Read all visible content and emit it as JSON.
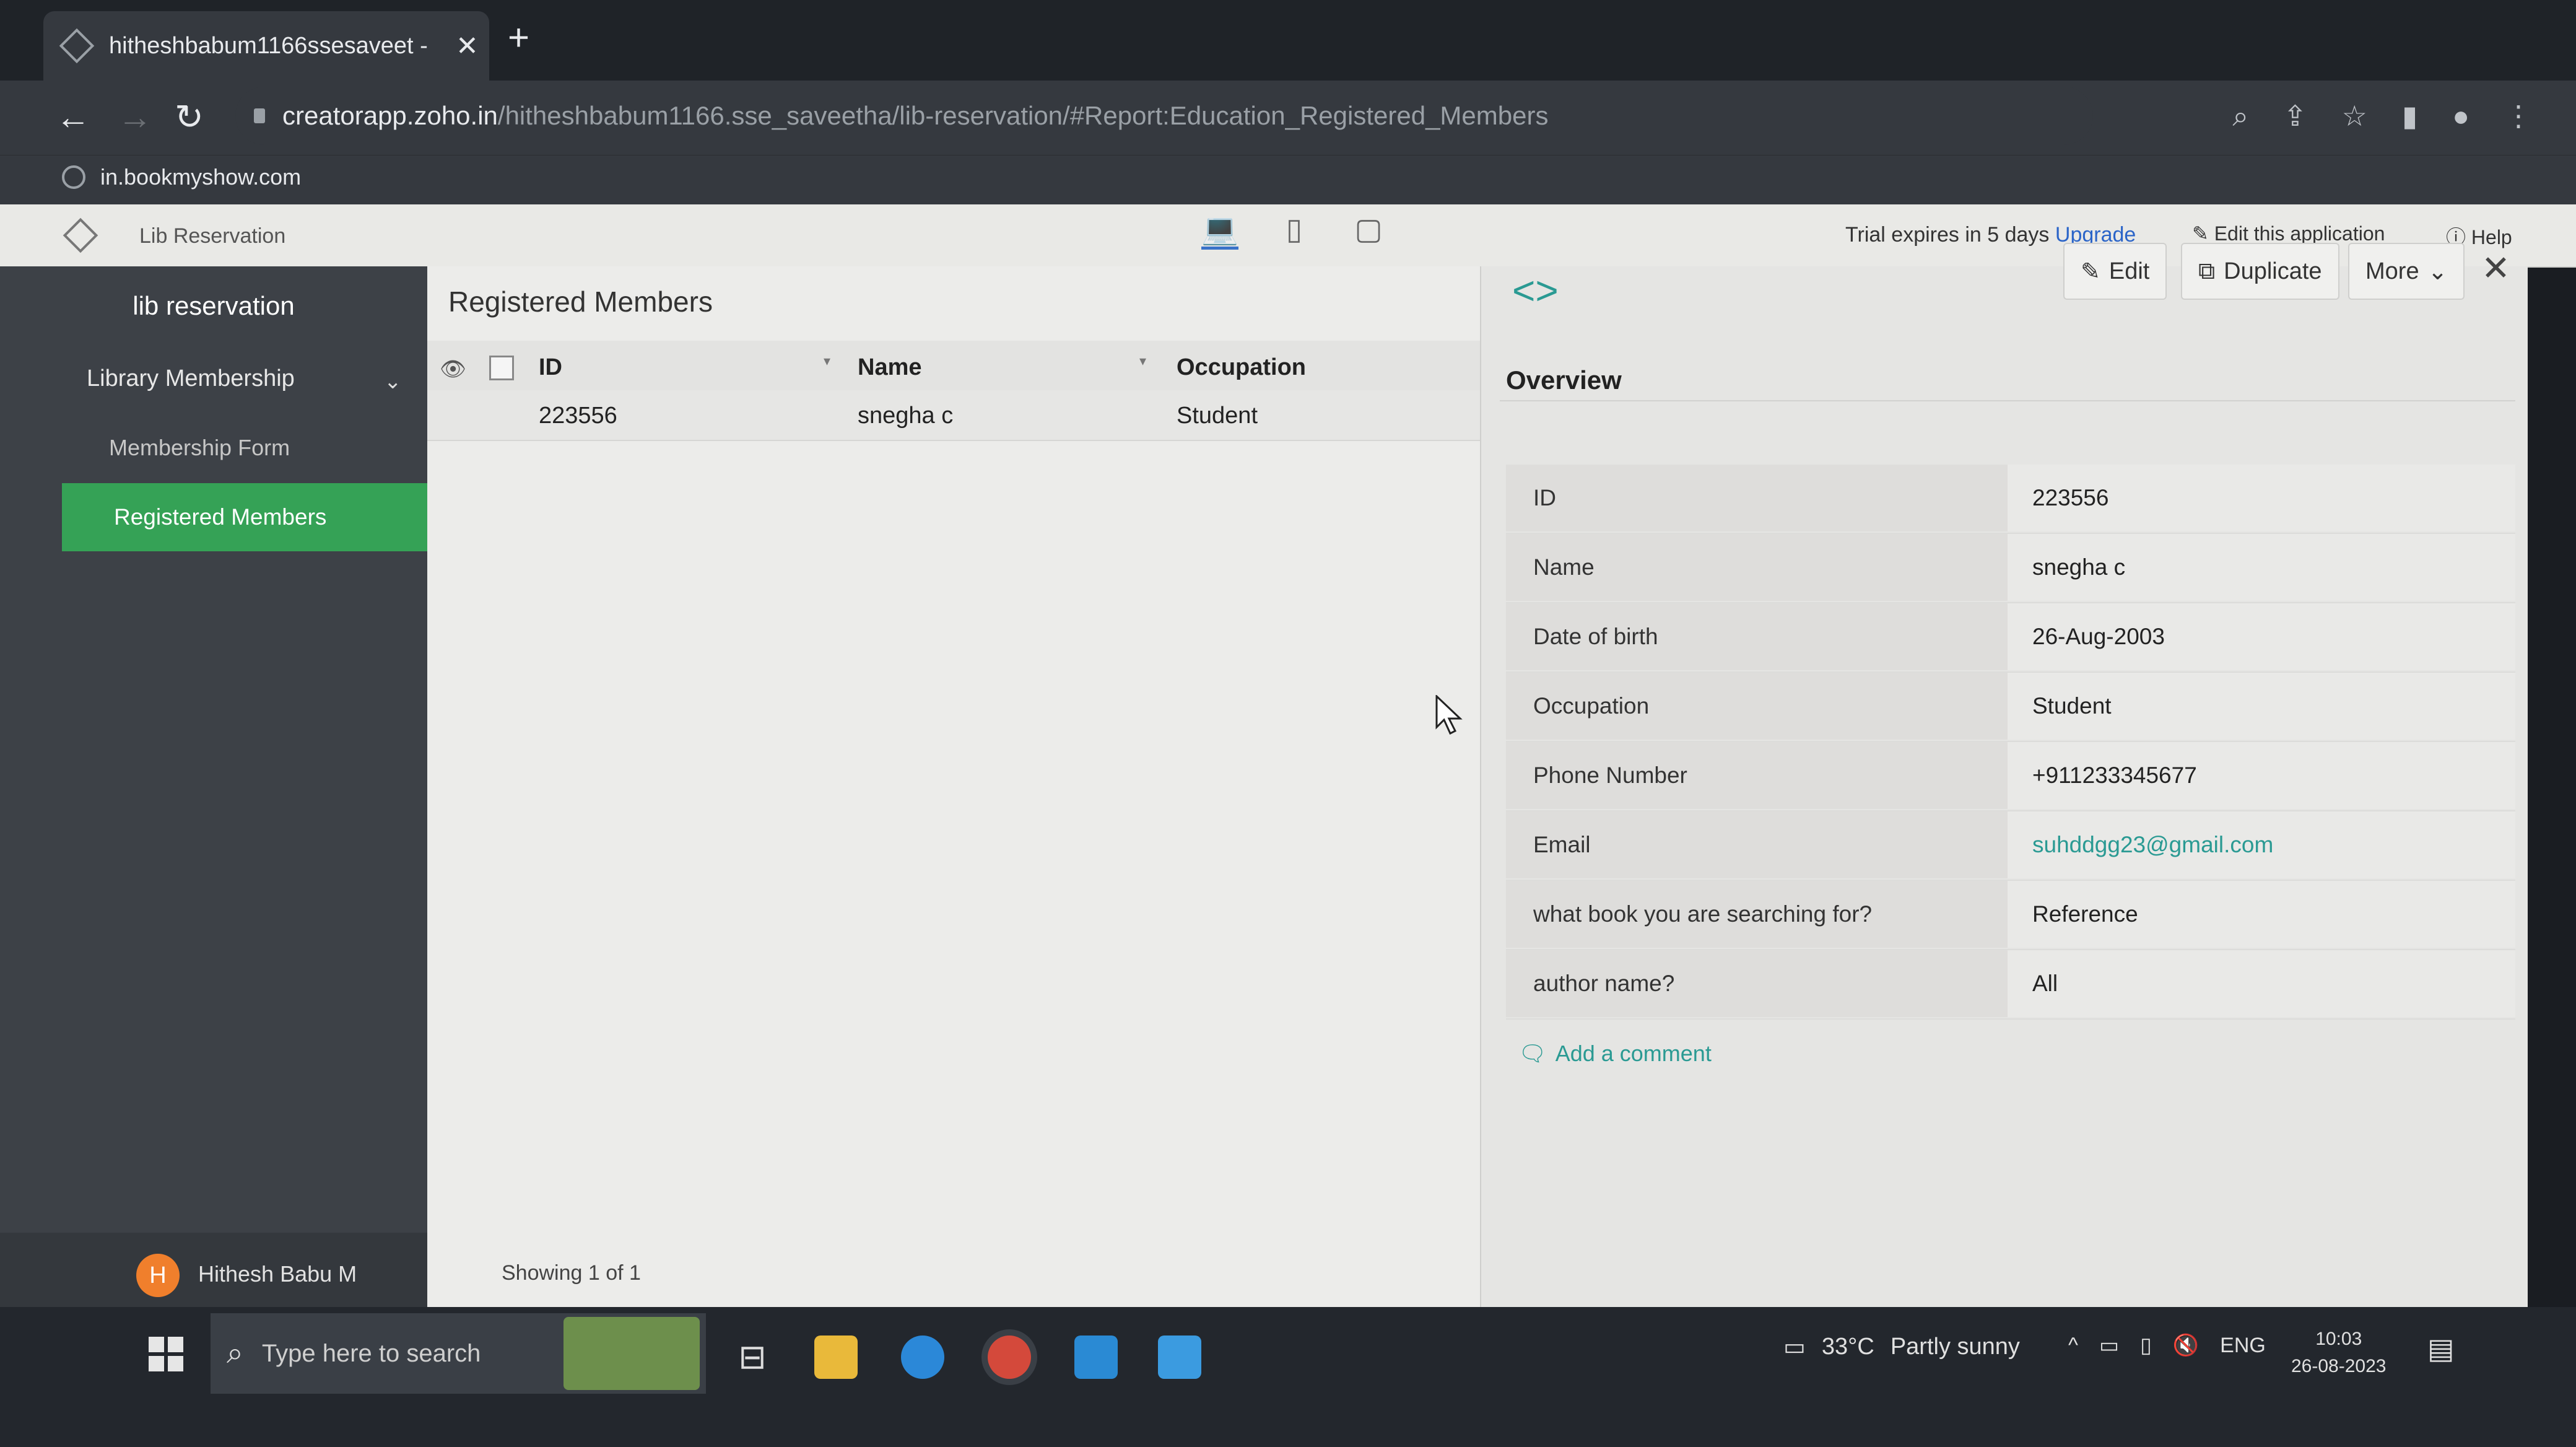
{
  "browser": {
    "tab_title": "hitheshbabum1166ssesaveet -",
    "url_host": "creatorapp.zoho.in",
    "url_path": "/hitheshbabum1166.sse_saveetha/lib-reservation/#Report:Education_Registered_Members",
    "bookmark": "in.bookmyshow.com"
  },
  "app_header": {
    "app_name": "Lib Reservation",
    "trial_text": "Trial expires in 5 days",
    "upgrade": "Upgrade",
    "edit_app": "Edit this application",
    "help": "Help"
  },
  "sidebar": {
    "title": "lib reservation",
    "section": "Library Membership",
    "items": [
      {
        "label": "Membership Form"
      },
      {
        "label": "Registered Members"
      }
    ],
    "user_initial": "H",
    "user_name": "Hithesh Babu M"
  },
  "report": {
    "title": "Registered Members",
    "columns": [
      "ID",
      "Name",
      "Occupation"
    ],
    "rows": [
      {
        "id": "223556",
        "name": "snegha c",
        "occupation": "Student"
      }
    ],
    "footer": "Showing 1 of 1"
  },
  "detail": {
    "edit": "Edit",
    "duplicate": "Duplicate",
    "more": "More",
    "overview": "Overview",
    "fields": [
      {
        "label": "ID",
        "value": "223556"
      },
      {
        "label": "Name",
        "value": "snegha c"
      },
      {
        "label": "Date of birth",
        "value": "26-Aug-2003"
      },
      {
        "label": "Occupation",
        "value": "Student"
      },
      {
        "label": "Phone Number",
        "value": "+911233345677"
      },
      {
        "label": "Email",
        "value": "suhddgg23@gmail.com"
      },
      {
        "label": "what book you are searching for?",
        "value": "Reference"
      },
      {
        "label": "author name?",
        "value": "All"
      }
    ],
    "add_comment": "Add a comment"
  },
  "taskbar": {
    "search_placeholder": "Type here to search",
    "temperature": "33°C",
    "weather": "Partly sunny",
    "lang": "ENG",
    "time": "10:03",
    "date": "26-08-2023"
  },
  "colors": {
    "accent_green": "#35a256",
    "link_teal": "#2a9a93",
    "upgrade_blue": "#2a64c8"
  }
}
